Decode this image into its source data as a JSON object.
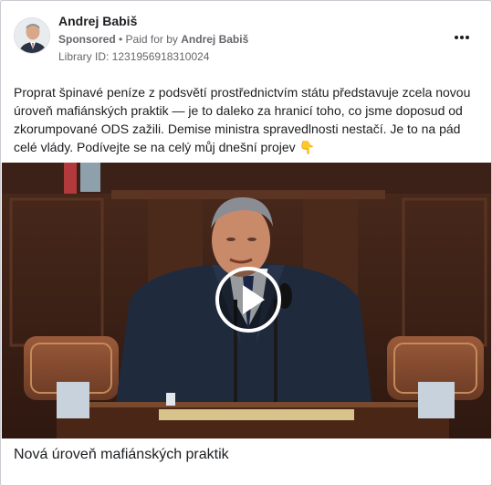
{
  "ad": {
    "page_name": "Andrej Babiš",
    "sponsored_label": "Sponsored",
    "separator": " • ",
    "paid_for_prefix": "Paid for by ",
    "paid_for_name": "Andrej Babiš",
    "library_id": "Library ID: 1231956918310024",
    "body_text": "Proprat špinavé peníze z podsvětí prostřednictvím státu představuje zcela novou úroveň mafiánských praktik — je to daleko za hranicí toho, co jsme doposud od zkorumpované ODS zažili. Demise ministra spravedlnosti nestačí. Je to na pád celé vlády. Podívejte se na celý můj dnešní projev 👇",
    "video_caption": "Nová úroveň mafiánských praktik"
  },
  "icons": {
    "more": "more-options-icon",
    "play": "play-icon"
  },
  "colors": {
    "text_primary": "#1c1e21",
    "text_secondary": "#65676b",
    "border": "#c9ccd1",
    "wood_dark": "#3a2218",
    "wood_mid": "#6b3e26"
  }
}
